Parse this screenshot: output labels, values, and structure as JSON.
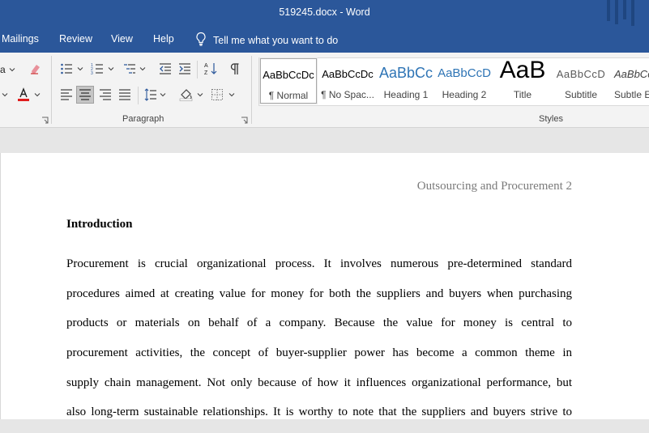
{
  "window": {
    "title": "519245.docx  -  Word"
  },
  "tabs": [
    "Mailings",
    "Review",
    "View",
    "Help"
  ],
  "tell_me": "Tell me what you want to do",
  "ribbon": {
    "paragraph_label": "Paragraph",
    "styles_label": "Styles",
    "font_fragment": "a",
    "styles": [
      {
        "preview": "AaBbCcDc",
        "name": "¶ Normal"
      },
      {
        "preview": "AaBbCcDc",
        "name": "¶ No Spac..."
      },
      {
        "preview": "AaBbCc",
        "name": "Heading 1"
      },
      {
        "preview": "AaBbCcD",
        "name": "Heading 2"
      },
      {
        "preview": "AaB",
        "name": "Title"
      },
      {
        "preview": "AaBbCcD",
        "name": "Subtitle"
      },
      {
        "preview": "AaBbCcD",
        "name": "Subtle Em"
      }
    ]
  },
  "document": {
    "header": "Outsourcing and Procurement 2",
    "heading": "Introduction",
    "lines": [
      "Procurement is crucial organizational process. It involves numerous pre-determined standard",
      "procedures aimed at creating value for money for both the suppliers and buyers when purchasing",
      "products or materials on behalf of a company. Because the value for money is central to",
      "procurement activities, the concept of buyer-supplier power has become a common theme in",
      "supply chain management. Not only because of how it influences organizational performance, but",
      "also long-term sustainable relationships. It is worthy to note that the suppliers and buyers strive to"
    ]
  }
}
